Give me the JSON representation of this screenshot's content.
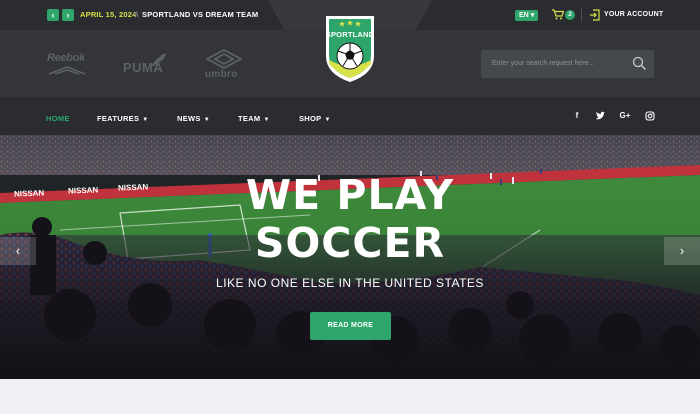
{
  "topbar": {
    "prev_icon": "chevron-left-icon",
    "next_icon": "chevron-right-icon",
    "date": "APRIL 15, 2024",
    "separator": "\\\\",
    "match": "SPORTLAND VS DREAM TEAM",
    "language": "EN",
    "cart_icon": "cart-icon",
    "cart_count": "2",
    "account_icon": "sign-in-icon",
    "account_label": "YOUR ACCOUNT"
  },
  "header": {
    "sponsors": [
      "Reebok",
      "PUMA",
      "umbro"
    ],
    "logo_text": "SPORTLAND",
    "search_placeholder": "Enter your search request here..."
  },
  "nav": {
    "items": [
      {
        "label": "HOME",
        "dropdown": false
      },
      {
        "label": "FEATURES",
        "dropdown": true
      },
      {
        "label": "NEWS",
        "dropdown": true
      },
      {
        "label": "TEAM",
        "dropdown": true
      },
      {
        "label": "SHOP",
        "dropdown": true
      }
    ],
    "social": [
      "facebook-icon",
      "twitter-icon",
      "google-plus-icon",
      "instagram-icon"
    ]
  },
  "hero": {
    "title_line1": "WE PLAY",
    "title_line2": "SOCCER",
    "subtitle": "LIKE NO ONE ELSE IN THE UNITED STATES",
    "cta_label": "READ MORE",
    "banner_text": "NISSAN"
  },
  "colors": {
    "accent": "#2ea56b",
    "date": "#d8e04a",
    "topbar": "#2a2c30",
    "header": "#333539"
  }
}
